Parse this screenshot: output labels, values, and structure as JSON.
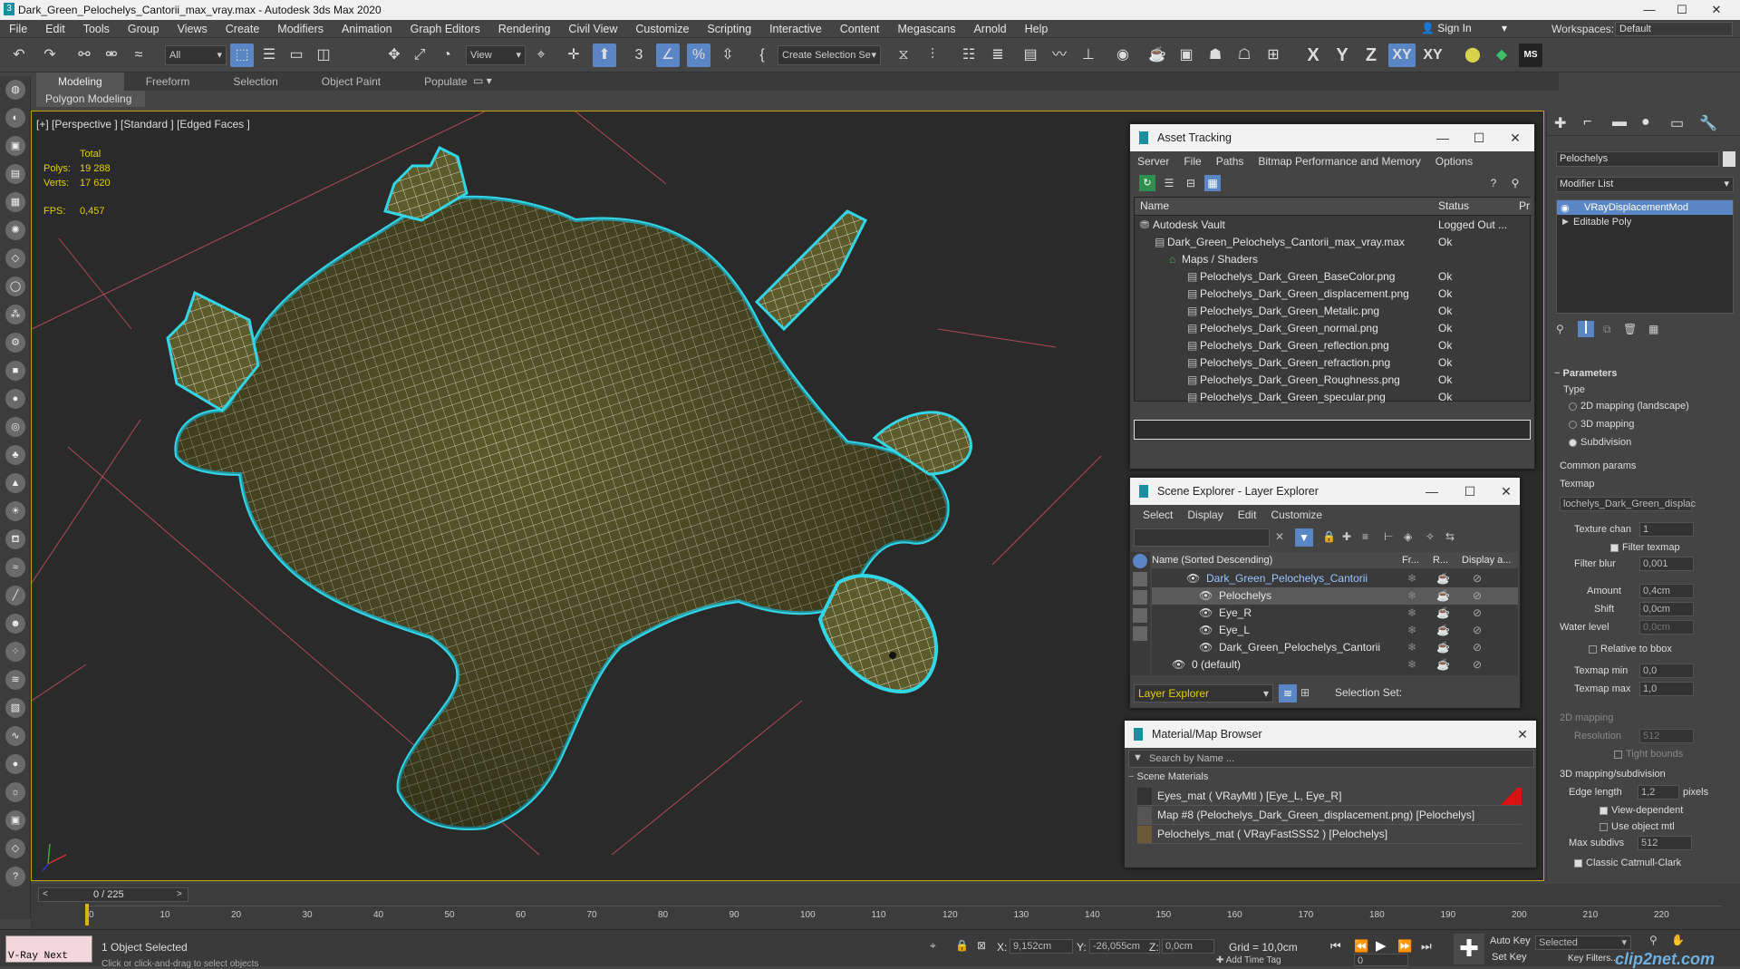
{
  "window": {
    "title": "Dark_Green_Pelochelys_Cantorii_max_vray.max - Autodesk 3ds Max 2020",
    "minimize": "—",
    "maximize": "☐",
    "close": "✕"
  },
  "menu": [
    "File",
    "Edit",
    "Tools",
    "Group",
    "Views",
    "Create",
    "Modifiers",
    "Animation",
    "Graph Editors",
    "Rendering",
    "Civil View",
    "Customize",
    "Scripting",
    "Interactive",
    "Content",
    "Megascans",
    "Arnold",
    "Help"
  ],
  "account": {
    "sign_in": "Sign In",
    "workspaces_label": "Workspaces:",
    "workspace": "Default"
  },
  "toolbar": {
    "filter": "All",
    "view": "View",
    "selection_set": "Create Selection Se",
    "axes": [
      "X",
      "Y",
      "Z",
      "XY",
      "XY"
    ]
  },
  "ribbon": {
    "tabs": [
      "Modeling",
      "Freeform",
      "Selection",
      "Object Paint",
      "Populate"
    ],
    "active_sub": "Polygon Modeling"
  },
  "viewport": {
    "label": "[+] [Perspective ] [Standard ] [Edged Faces ]",
    "total": "Total",
    "polys_label": "Polys:",
    "polys": "19 288",
    "verts_label": "Verts:",
    "verts": "17 620",
    "fps_label": "FPS:",
    "fps": "0,457"
  },
  "asset_tracking": {
    "title": "Asset Tracking",
    "menu": [
      "Server",
      "File",
      "Paths",
      "Bitmap Performance and Memory",
      "Options"
    ],
    "col_name": "Name",
    "col_status": "Status",
    "col_pr": "Pr",
    "rows": [
      {
        "name": "Autodesk Vault",
        "status": "Logged Out ..."
      },
      {
        "name": "Dark_Green_Pelochelys_Cantorii_max_vray.max",
        "status": "Ok"
      },
      {
        "name": "Maps / Shaders",
        "status": ""
      },
      {
        "name": "Pelochelys_Dark_Green_BaseColor.png",
        "status": "Ok"
      },
      {
        "name": "Pelochelys_Dark_Green_displacement.png",
        "status": "Ok"
      },
      {
        "name": "Pelochelys_Dark_Green_Metalic.png",
        "status": "Ok"
      },
      {
        "name": "Pelochelys_Dark_Green_normal.png",
        "status": "Ok"
      },
      {
        "name": "Pelochelys_Dark_Green_reflection.png",
        "status": "Ok"
      },
      {
        "name": "Pelochelys_Dark_Green_refraction.png",
        "status": "Ok"
      },
      {
        "name": "Pelochelys_Dark_Green_Roughness.png",
        "status": "Ok"
      },
      {
        "name": "Pelochelys_Dark_Green_specular.png",
        "status": "Ok"
      }
    ]
  },
  "scene_explorer": {
    "title": "Scene Explorer - Layer Explorer",
    "menu": [
      "Select",
      "Display",
      "Edit",
      "Customize"
    ],
    "col_name": "Name (Sorted Descending)",
    "col_fr": "Fr...",
    "col_r": "R...",
    "col_disp": "Display a...",
    "rows": [
      "Dark_Green_Pelochelys_Cantorii",
      "Pelochelys",
      "Eye_R",
      "Eye_L",
      "Dark_Green_Pelochelys_Cantorii",
      "0 (default)"
    ],
    "footer_left": "Layer Explorer",
    "footer_right": "Selection Set:"
  },
  "material_browser": {
    "title": "Material/Map Browser",
    "search": "Search by Name ...",
    "section": "Scene Materials",
    "items": [
      "Eyes_mat  ( VRayMtl ) [Eye_L, Eye_R]",
      "Map #8 (Pelochelys_Dark_Green_displacement.png) [Pelochelys]",
      "Pelochelys_mat  ( VRayFastSSS2 ) [Pelochelys]"
    ]
  },
  "command_panel": {
    "object_name": "Pelochelys",
    "modifier_list": "Modifier List",
    "stack": [
      "VRayDisplacementMod",
      "Editable Poly"
    ],
    "rollout": "Parameters",
    "type_label": "Type",
    "types": [
      "2D mapping (landscape)",
      "3D mapping",
      "Subdivision"
    ],
    "common": "Common params",
    "texmap_label": "Texmap",
    "texmap": "lochelys_Dark_Green_displac",
    "texture_chan_label": "Texture chan",
    "texture_chan": "1",
    "filter_texmap": "Filter texmap",
    "filter_blur_label": "Filter blur",
    "filter_blur": "0,001",
    "amount_label": "Amount",
    "amount": "0,4cm",
    "shift_label": "Shift",
    "shift": "0,0cm",
    "water_label": "Water level",
    "water": "0,0cm",
    "relative": "Relative to bbox",
    "texmap_min_label": "Texmap min",
    "texmap_min": "0,0",
    "texmap_max_label": "Texmap max",
    "texmap_max": "1,0",
    "mapping2d": "2D mapping",
    "resolution_label": "Resolution",
    "resolution": "512",
    "tight": "Tight bounds",
    "mapping3d": "3D mapping/subdivision",
    "edge_label": "Edge length",
    "edge": "1,2",
    "pixels": "pixels",
    "view_dep": "View-dependent",
    "use_obj": "Use object mtl",
    "max_subdivs_label": "Max subdivs",
    "max_subdivs": "512",
    "catmull": "Classic Catmull-Clark"
  },
  "timeline": {
    "frame": "0 / 225",
    "ticks": [
      "0",
      "10",
      "20",
      "30",
      "40",
      "50",
      "60",
      "70",
      "80",
      "90",
      "100",
      "110",
      "120",
      "130",
      "140",
      "150",
      "160",
      "170",
      "180",
      "190",
      "200",
      "210",
      "220"
    ]
  },
  "status": {
    "script": "V-Ray Next",
    "selected": "1 Object Selected",
    "hint": "Click or click-and-drag to select objects",
    "x_label": "X:",
    "x": "9,152cm",
    "y_label": "Y:",
    "y": "-26,055cm",
    "z_label": "Z:",
    "z": "0,0cm",
    "grid": "Grid = 10,0cm",
    "auto_key": "Auto Key",
    "set_key": "Set Key",
    "selected_dd": "Selected",
    "key_filters": "Key Filters...",
    "add_time_tag": "Add Time Tag",
    "frame_field": "0",
    "watermark": "clip2net.com"
  },
  "colors": {
    "accent": "#5b86c5",
    "selection_outline": "#33d6e6",
    "mesh_fill": "#5b5a2c",
    "grid_line": "#b04a5a"
  }
}
